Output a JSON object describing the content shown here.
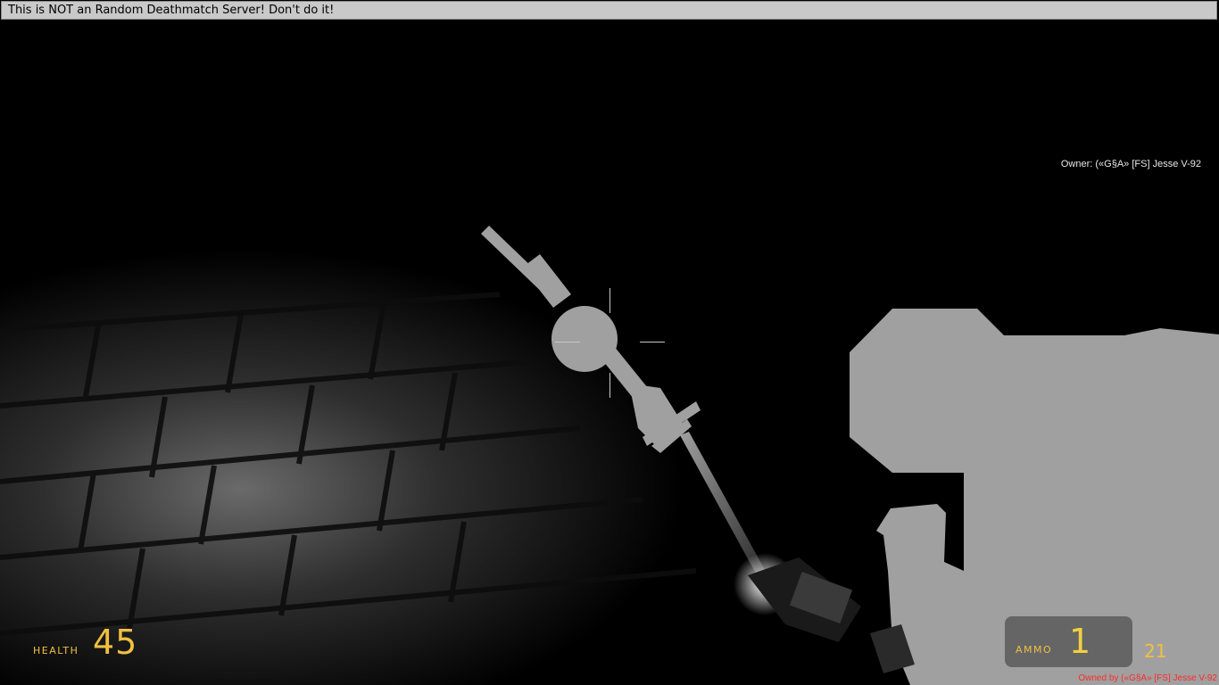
{
  "banner": {
    "text": "This is NOT an Random Deathmatch Server! Don't do it!"
  },
  "overlay": {
    "owner_label": "Owner: («G§A» [FS] Jesse V-92"
  },
  "hud": {
    "health": {
      "label": "HEALTH",
      "value": "45"
    },
    "ammo": {
      "label": "AMMO",
      "clip": "1",
      "reserve": "21"
    },
    "owned_by": "Owned by («G§A» [FS] Jesse V-92"
  },
  "colors": {
    "hud_yellow": "#f0c040",
    "owner_red": "#ff2a2a",
    "banner_bg": "#c9c9c9",
    "silhouette": "#a0a0a0"
  }
}
